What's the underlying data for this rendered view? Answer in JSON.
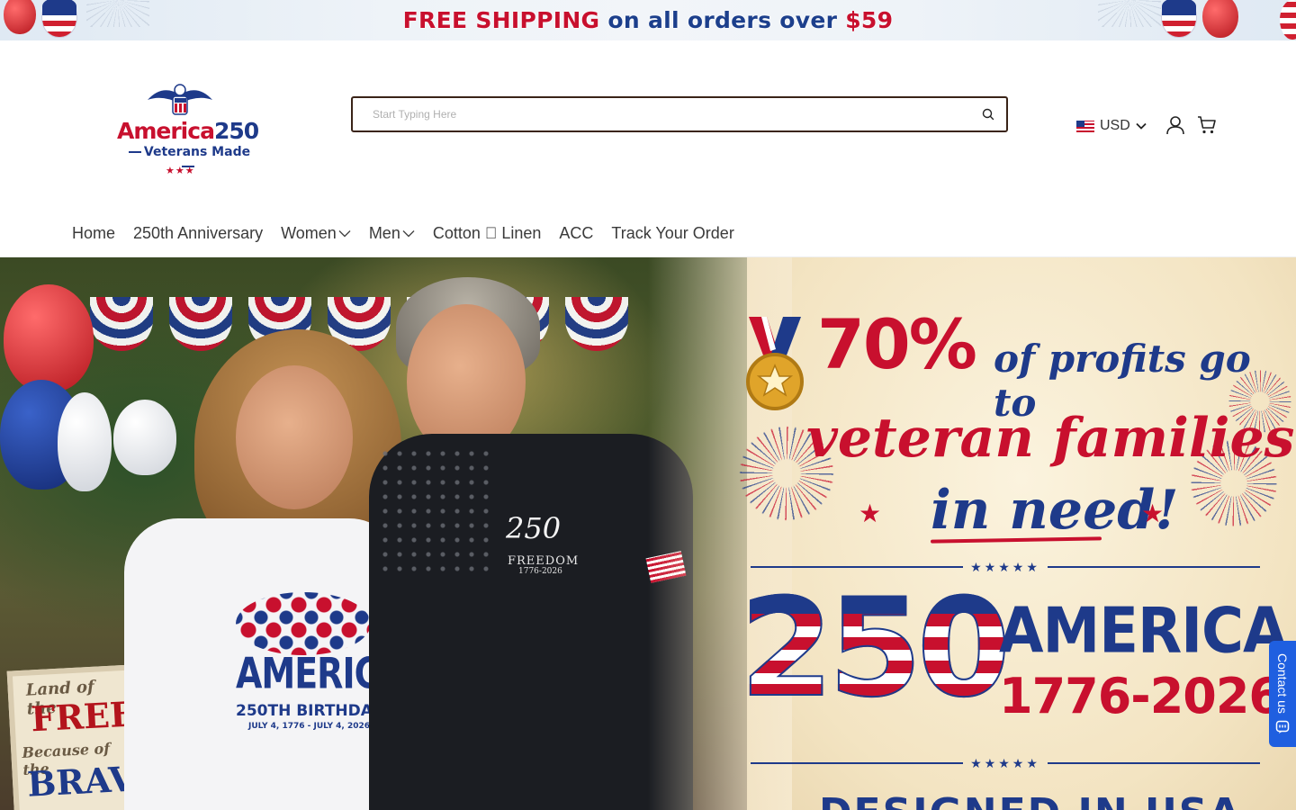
{
  "announcement": {
    "part1": "FREE SHIPPING",
    "part2": "on all orders over",
    "part3": "$59"
  },
  "logo": {
    "line1_a": "America",
    "line1_b": "250",
    "line2": "Veterans Made"
  },
  "search": {
    "placeholder": "Start Typing Here",
    "icon": "search-icon"
  },
  "currency": {
    "flag": "us-flag-icon",
    "code": "USD"
  },
  "header_icons": [
    "account-icon",
    "cart-icon"
  ],
  "nav": {
    "items": [
      {
        "label": "Home",
        "has_dropdown": false
      },
      {
        "label": "250th Anniversary",
        "has_dropdown": false
      },
      {
        "label": "Women",
        "has_dropdown": true
      },
      {
        "label": "Men",
        "has_dropdown": true
      },
      {
        "label": "Cotton \u0000 Linen",
        "has_dropdown": false
      },
      {
        "label": "ACC",
        "has_dropdown": false
      },
      {
        "label": "Track Your Order",
        "has_dropdown": false
      }
    ]
  },
  "hero": {
    "headline_number": "70%",
    "headline_script_1": "of profits go to",
    "headline_script_2": "veteran families",
    "headline_script_3": "in need!",
    "big_number": "250",
    "big_word": "AMERICA",
    "years": "1776-2026",
    "designed": "DESIGNED IN USA",
    "tee": {
      "word": "AMERICA",
      "line": "250TH BIRTHDAY",
      "dates": "JULY 4, 1776 - JULY 4, 2026"
    },
    "polo": {
      "number": "250",
      "word": "FREEDOM",
      "dates": "1776-2026"
    },
    "sign": {
      "l1": "Land of the",
      "l2": "FREE",
      "l3": "Because of the",
      "l4": "BRAVE"
    }
  },
  "contact_tab": {
    "label": "Contact us",
    "icon": "chat-icon"
  },
  "colors": {
    "brand_red": "#c8102e",
    "brand_blue": "#1e3a8a",
    "contact_blue": "#1f5fe0",
    "search_border": "#3a2418"
  }
}
